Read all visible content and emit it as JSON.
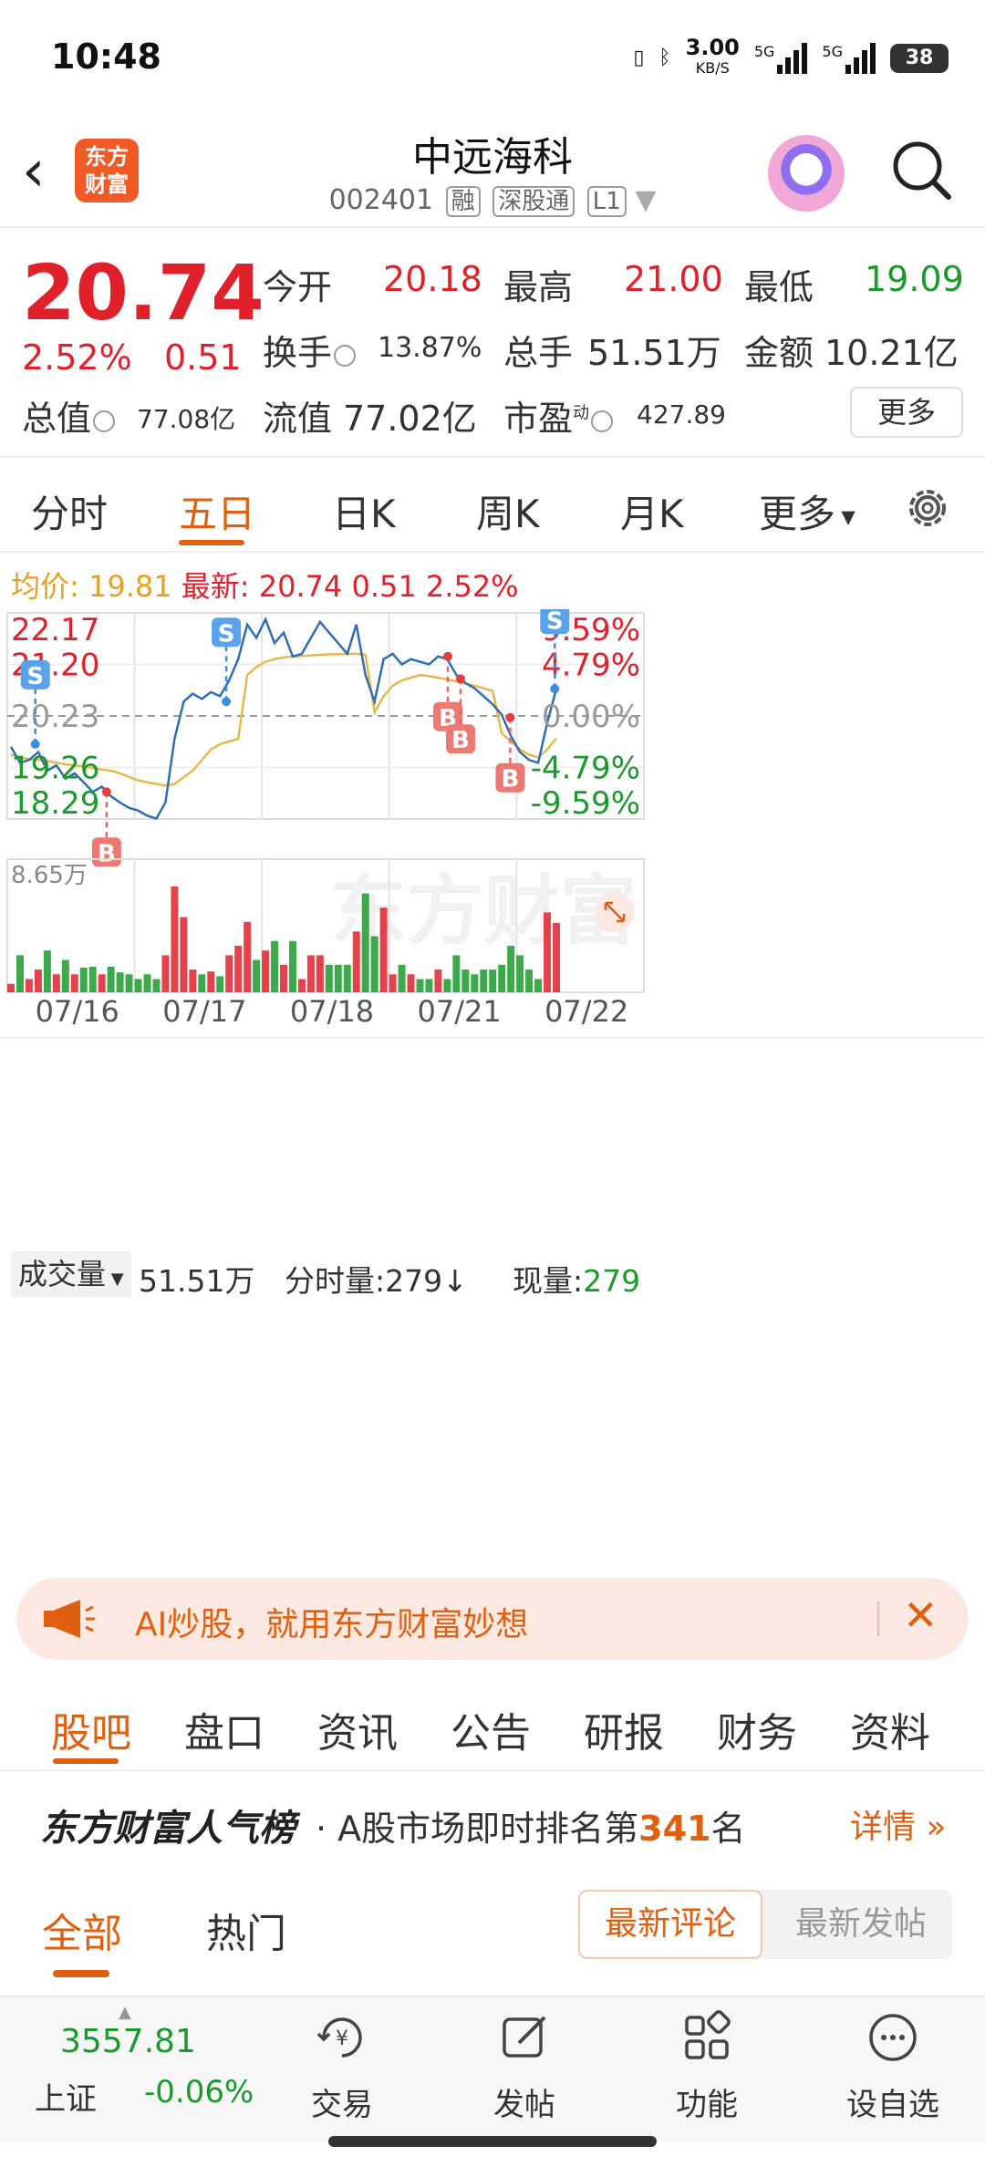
{
  "status": {
    "time": "10:48",
    "net_speed": "3.00",
    "net_unit": "KB/S",
    "sig1": "5G",
    "sig2": "5G",
    "battery": "38"
  },
  "nav": {
    "title": "中远海科",
    "code": "002401",
    "tags": [
      "融",
      "深股通",
      "L1"
    ]
  },
  "quote": {
    "price": "20.74",
    "change_pct": "2.52%",
    "change_abs": "0.51",
    "open_label": "今开",
    "open": "20.18",
    "high_label": "最高",
    "high": "21.00",
    "low_label": "最低",
    "low": "19.09",
    "turnover_label": "换手",
    "turnover": "13.87%",
    "volume_label": "总手",
    "volume": "51.51万",
    "amount_label": "金额",
    "amount": "10.21亿",
    "mcap_label": "总值",
    "mcap": "77.08亿",
    "float_label": "流值",
    "float": "77.02亿",
    "pe_label": "市盈",
    "pe_sup": "动",
    "pe": "427.89",
    "more": "更多"
  },
  "tabs": [
    "分时",
    "五日",
    "日K",
    "周K",
    "月K",
    "更多"
  ],
  "avg": {
    "avg_label": "均价:",
    "avg": "19.81",
    "last_label": "最新:",
    "last": "20.74",
    "chg": "0.51",
    "pct": "2.52%"
  },
  "chart_data": {
    "type": "line",
    "title": "",
    "xlabel": "",
    "ylabel": "",
    "x_ticks": [
      "07/16",
      "07/17",
      "07/18",
      "07/21",
      "07/22"
    ],
    "y_left_ticks": [
      "22.17",
      "21.20",
      "20.23",
      "19.26",
      "18.29"
    ],
    "y_right_ticks": [
      "9.59%",
      "4.79%",
      "0.00%",
      "-4.79%",
      "-9.59%"
    ],
    "ylim": [
      18.29,
      22.17
    ],
    "watermark": "东方财富",
    "series": [
      {
        "values": [
          19.65,
          19.35,
          19.4,
          19.55,
          19.2,
          19.3,
          19.05,
          19.15,
          18.98,
          18.8,
          18.9,
          18.72,
          18.6,
          18.5,
          18.45,
          18.35,
          18.3,
          18.6,
          19.8,
          20.5,
          20.65,
          20.55,
          20.68,
          20.6,
          20.9,
          21.3,
          21.95,
          21.7,
          22.05,
          21.6,
          21.8,
          21.35,
          21.4,
          21.7,
          22.0,
          21.8,
          21.6,
          21.4,
          21.95,
          21.0,
          20.5,
          21.3,
          21.4,
          21.2,
          21.3,
          21.25,
          21.2,
          21.35,
          21.3,
          21.0,
          20.85,
          20.75,
          20.6,
          20.45,
          20.25,
          19.85,
          19.55,
          19.4,
          19.35,
          20.1,
          20.74
        ]
      },
      {
        "values": [
          19.5,
          19.45,
          19.42,
          19.4,
          19.38,
          19.35,
          19.32,
          19.3,
          19.28,
          19.25,
          19.22,
          19.2,
          19.15,
          19.08,
          19.02,
          18.98,
          18.95,
          18.92,
          18.95,
          19.08,
          19.2,
          19.4,
          19.6,
          19.7,
          19.75,
          19.8,
          21.0,
          21.15,
          21.25,
          21.3,
          21.33,
          21.35,
          21.36,
          21.37,
          21.38,
          21.39,
          21.39,
          21.4,
          21.4,
          21.38,
          20.3,
          20.6,
          20.8,
          20.9,
          20.95,
          21.0,
          20.98,
          20.95,
          20.92,
          20.88,
          20.84,
          20.8,
          20.75,
          20.7,
          19.9,
          19.75,
          19.6,
          19.5,
          19.45,
          19.6,
          19.81
        ]
      }
    ],
    "markers": [
      {
        "label": "S",
        "day": "07/16",
        "price": 19.7
      },
      {
        "label": "B",
        "day": "07/16",
        "price": 18.8
      },
      {
        "label": "S",
        "day": "07/17",
        "price": 20.5
      },
      {
        "label": "B",
        "day": "07/21",
        "price": 21.35
      },
      {
        "label": "B",
        "day": "07/21",
        "price": 20.93
      },
      {
        "label": "B",
        "day": "07/21",
        "price": 20.2
      },
      {
        "label": "S",
        "day": "07/22",
        "price": 20.74
      }
    ],
    "volume_max_label": "8.65万"
  },
  "volume": {
    "label": "成交量",
    "total": "51.51万",
    "tick_label": "分时量:279↓",
    "now_label": "现量:",
    "now": "279"
  },
  "banner": {
    "text": "AI炒股，就用东方财富妙想"
  },
  "subtabs": [
    "股吧",
    "盘口",
    "资讯",
    "公告",
    "研报",
    "财务",
    "资料"
  ],
  "hot": {
    "brand": "东方财富人气榜",
    "text_pre": "· A股市场即时排名第",
    "rank": "341",
    "text_post": "名",
    "detail": "详情 »"
  },
  "filter": {
    "tab1": "全部",
    "tab2": "热门",
    "seg1": "最新评论",
    "seg2": "最新发帖"
  },
  "bottom": {
    "index_value": "3557.81",
    "index_name": "上证",
    "index_change": "-0.06%",
    "items": [
      "交易",
      "发帖",
      "功能",
      "设自选"
    ]
  },
  "colors": {
    "up": "#e0212b",
    "down": "#1a9a2a",
    "accent": "#e06010",
    "line": "#2f6db5",
    "avg": "#e8b84a"
  }
}
